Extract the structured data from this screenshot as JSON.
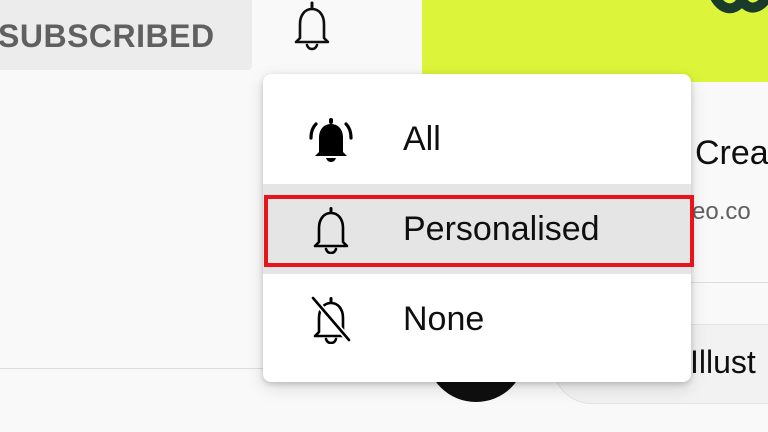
{
  "subscribe": {
    "label": "SUBSCRIBED"
  },
  "notifications_menu": {
    "items": [
      {
        "label": "All",
        "icon": "bell-ringing-icon",
        "selected": false
      },
      {
        "label": "Personalised",
        "icon": "bell-outline-icon",
        "selected": true
      },
      {
        "label": "None",
        "icon": "bell-off-icon",
        "selected": false
      }
    ]
  },
  "video": {
    "title_fragment": "Crea",
    "subtitle_fragment": "eo.co"
  },
  "chip": {
    "label": "Illust"
  },
  "colors": {
    "thumbnail": "#dcf53a",
    "highlight": "#e8141c",
    "selected_bg": "#e5e5e5"
  }
}
